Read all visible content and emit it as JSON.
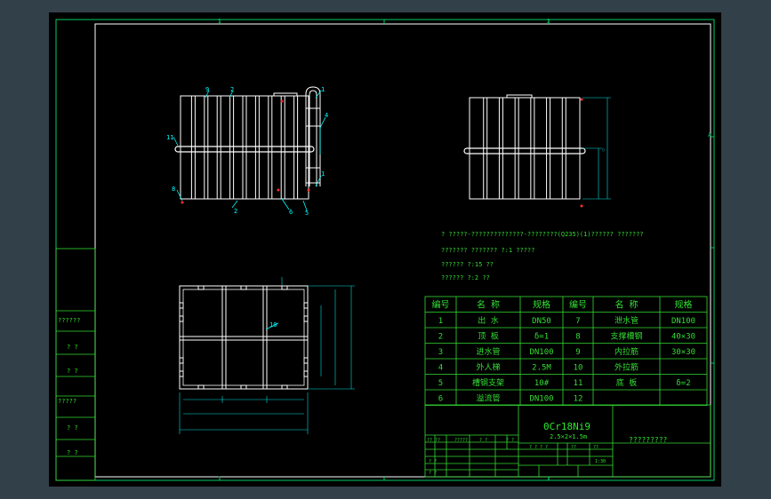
{
  "colors": {
    "background": "#324049",
    "sheet": "#000000",
    "frame": "#00cc66",
    "table": "#33dd33",
    "drawing": "#ffffff",
    "annotation": "#00ffff",
    "title": "#2ee62e",
    "marker": "#ff3030",
    "dim": "#00e0e0"
  },
  "border": {
    "top_letters": [
      "1",
      "2"
    ],
    "bottom_letters": [
      "1",
      "2"
    ],
    "side_letters": [
      "A"
    ]
  },
  "front_view": {
    "callouts": [
      "9",
      "2",
      "1",
      "4",
      "11",
      "1",
      "8",
      "2",
      "6",
      "5"
    ]
  },
  "plan_view": {
    "callouts": [
      "10"
    ]
  },
  "notes": [
    "? ?????-??????????????-????????(Q235)(1)?????? ???????",
    "??????? ???????      ?:1 ?????",
    "??????   ?:15 ??",
    "??????   ?:2 ??"
  ],
  "parts_table": {
    "headers": [
      "编号",
      "名 称",
      "规格",
      "编号",
      "名 称",
      "规格"
    ],
    "rows": [
      [
        "1",
        "出 水",
        "DN50",
        "7",
        "泄水管",
        "DN100"
      ],
      [
        "2",
        "顶 板",
        "δ=1",
        "8",
        "支撑槽钢",
        "40×30"
      ],
      [
        "3",
        "进水管",
        "DN100",
        "9",
        "内拉筋",
        "30×30"
      ],
      [
        "4",
        "外人梯",
        "2.5M",
        "10",
        "外拉筋",
        ""
      ],
      [
        "5",
        "槽钢支架",
        "10#",
        "11",
        "底 板",
        "δ=2"
      ],
      [
        "6",
        "溢流管",
        "DN100",
        "12",
        "",
        ""
      ]
    ]
  },
  "title_block": {
    "material": "0Cr18Ni9",
    "dimensions": "2.5×2×1.5m",
    "drawing_title": "?????????",
    "cells": [
      "?? ??",
      "?????",
      "? ?",
      "? ?",
      "? ? ? ?",
      "??",
      "??",
      "1:30",
      "? ?",
      "? ?"
    ]
  }
}
